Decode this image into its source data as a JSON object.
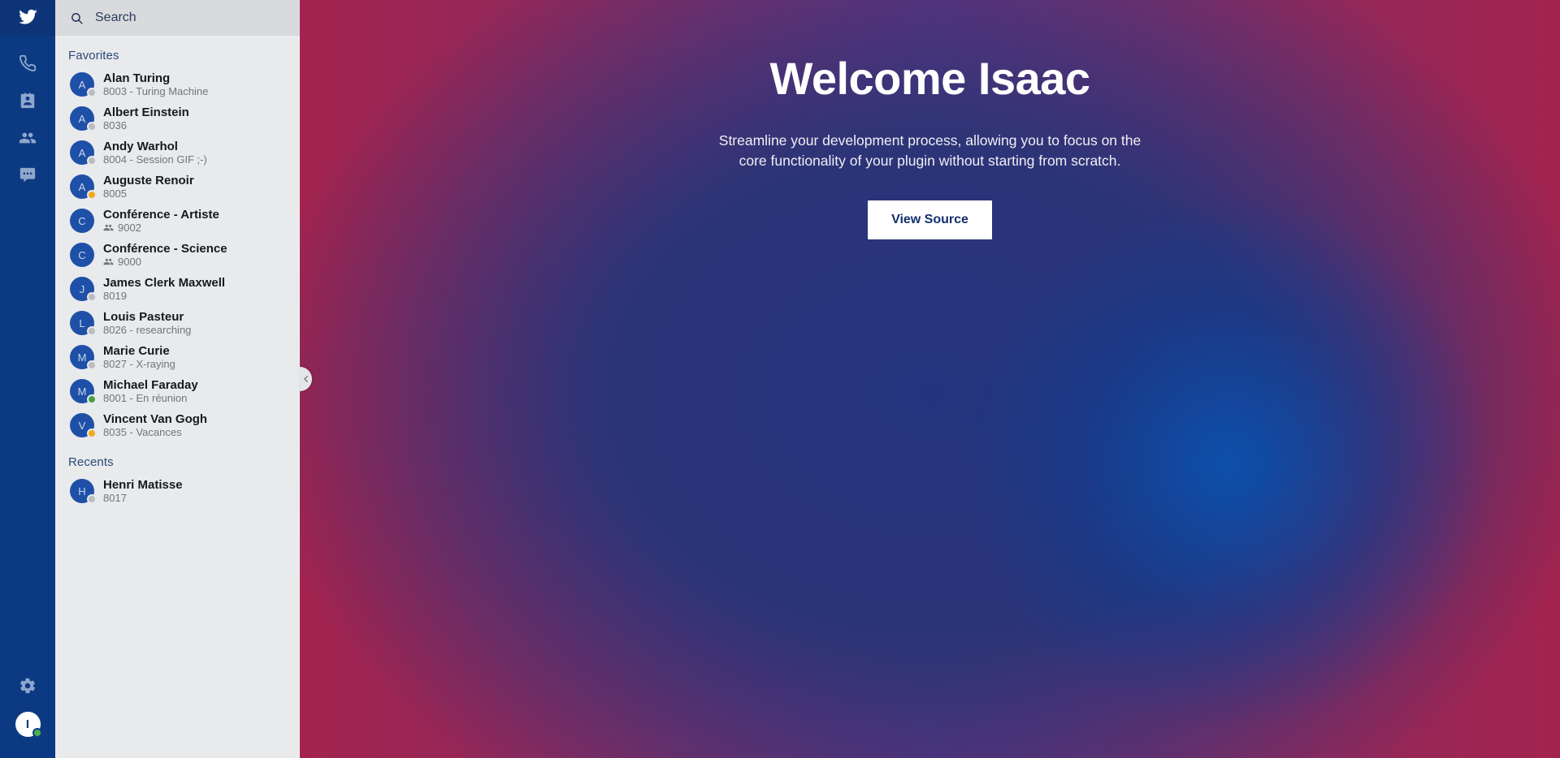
{
  "rail": {
    "logo": {
      "icon": "bird-logo-icon",
      "label": "Wazo"
    },
    "items": [
      {
        "icon": "phone-icon",
        "name": "calls"
      },
      {
        "icon": "contact-card-icon",
        "name": "contacts"
      },
      {
        "icon": "group-people-icon",
        "name": "groups"
      },
      {
        "icon": "chat-bubble-icon",
        "name": "chat"
      }
    ],
    "settings": {
      "icon": "gear-icon",
      "name": "settings"
    },
    "user_avatar": {
      "initial": "I",
      "status": "online",
      "status_color": "#4caf50"
    }
  },
  "search": {
    "icon": "search-icon",
    "placeholder": "Search",
    "value": ""
  },
  "sections": [
    {
      "title": "Favorites",
      "contacts": [
        {
          "initial": "A",
          "name": "Alan Turing",
          "sub": "8003 - Turing Machine",
          "status": "offline",
          "type": "user"
        },
        {
          "initial": "A",
          "name": "Albert Einstein",
          "sub": "8036",
          "status": "offline",
          "type": "user"
        },
        {
          "initial": "A",
          "name": "Andy Warhol",
          "sub": "8004 - Session GIF ;-)",
          "status": "offline",
          "type": "user"
        },
        {
          "initial": "A",
          "name": "Auguste Renoir",
          "sub": "8005",
          "status": "away",
          "type": "user"
        },
        {
          "initial": "C",
          "name": "Conférence - Artiste",
          "sub": "9002",
          "status": "none",
          "type": "conference"
        },
        {
          "initial": "C",
          "name": "Conférence - Science",
          "sub": "9000",
          "status": "none",
          "type": "conference"
        },
        {
          "initial": "J",
          "name": "James Clerk Maxwell",
          "sub": "8019",
          "status": "offline",
          "type": "user"
        },
        {
          "initial": "L",
          "name": "Louis Pasteur",
          "sub": "8026 - researching",
          "status": "offline",
          "type": "user"
        },
        {
          "initial": "M",
          "name": "Marie Curie",
          "sub": "8027 - X-raying",
          "status": "offline",
          "type": "user"
        },
        {
          "initial": "M",
          "name": "Michael Faraday",
          "sub": "8001 - En réunion",
          "status": "online",
          "type": "user"
        },
        {
          "initial": "V",
          "name": "Vincent Van Gogh",
          "sub": "8035 - Vacances",
          "status": "away",
          "type": "user"
        }
      ]
    },
    {
      "title": "Recents",
      "contacts": [
        {
          "initial": "H",
          "name": "Henri Matisse",
          "sub": "8017",
          "status": "offline",
          "type": "user"
        }
      ]
    }
  ],
  "collapse": {
    "icon": "chevron-left-icon"
  },
  "hero": {
    "title": "Welcome Isaac",
    "description": "Streamline your development process, allowing you to focus on the core functionality of your plugin without starting from scratch.",
    "button_label": "View Source"
  },
  "colors": {
    "rail_bg": "#0c3a82",
    "panel_bg": "#e9eaec",
    "search_bg": "#d9dadd",
    "accent_blue": "#1e50a8",
    "status_online": "#43a047",
    "status_away": "#f0a91e",
    "status_offline": "#b9bcc1",
    "stage_crimson": "#a3234e",
    "stage_purple": "#6d3380",
    "stage_blue": "#23347e",
    "button_text": "#14306e"
  }
}
